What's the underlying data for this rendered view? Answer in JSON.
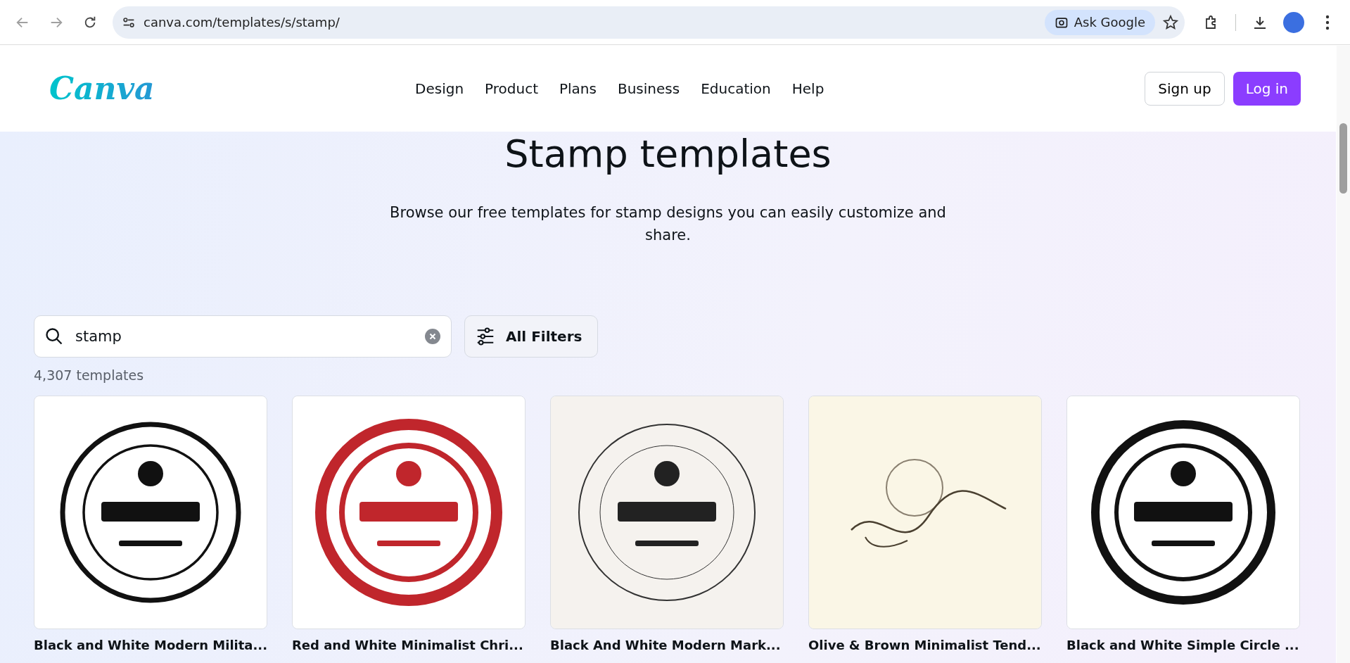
{
  "browser": {
    "url": "canva.com/templates/s/stamp/",
    "ask_button": "Ask Google"
  },
  "header": {
    "logo": "Canva",
    "nav": [
      "Design",
      "Product",
      "Plans",
      "Business",
      "Education",
      "Help"
    ],
    "signup": "Sign up",
    "login": "Log in"
  },
  "hero": {
    "title": "Stamp templates",
    "description": "Browse our free templates for stamp designs you can easily customize and share."
  },
  "search": {
    "value": "stamp",
    "filters_button": "All Filters"
  },
  "count": "4,307 templates",
  "templates": [
    {
      "title": "Black and White Modern Milita...",
      "kind": "picture"
    },
    {
      "title": "Red and White Minimalist Chri...",
      "kind": "picture"
    },
    {
      "title": "Black And White Modern Mark...",
      "kind": "picture"
    },
    {
      "title": "Olive & Brown Minimalist Tend...",
      "kind": "picture"
    },
    {
      "title": "Black and White Simple Circle ...",
      "kind": "picture"
    }
  ]
}
